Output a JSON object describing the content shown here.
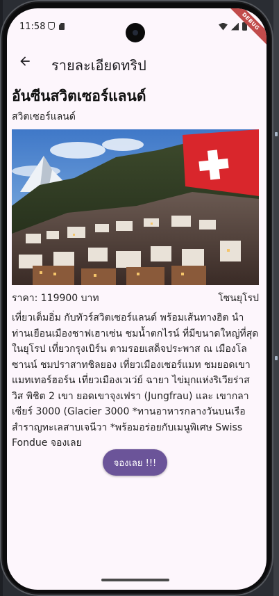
{
  "status_bar": {
    "time": "11:58",
    "icons": [
      "shield-icon",
      "sim-card-icon",
      "wifi-icon",
      "signal-icon",
      "battery-icon"
    ]
  },
  "debug_banner": "DEBUG",
  "app_bar": {
    "back_icon": "arrow-back-icon",
    "title": "รายละเอียดทริป"
  },
  "trip": {
    "name": "อันซีนสวิตเซอร์แลนด์",
    "country": "สวิตเซอร์แลนด์",
    "image_alt": "Matterhorn mountain village with Swiss flag",
    "price_label": "ราคา: 119900 บาท",
    "region": "โซนยุโรป",
    "description": "เที่ยวเต็มอิ่ม กับทัวร์สวิตเซอร์แลนด์ พร้อมเส้นทางฮิต นำท่านเยือนเมืองชาฟเฮาเซ่น ชมน้ำตกไรน์ ที่มีขนาดใหญ่ที่สุดในยุโรป เที่ยวกรุงเบิร์น ตามรอยเสด็จประพาส ณ เมืองโลซานน์ ชมปราสาทชิลยอง เที่ยวเมืองเซอร์แมท ชมยอดเขาแมทเทอร์ฮอร์น เที่ยวเมืองเวเว่ย์ ฉายา ไข่มุกแห่งริเวียร่าสวิส พิชิต 2 เขา ยอดเขาจุงเฟรา (Jungfrau) และ เขากลาเซียร์ 3000 (Glacier 3000 *ทานอาหารกลางวันบนเรือสำราญทะเลสาบเจนีวา *พร้อมอร่อยกับเมนูพิเศษ Swiss Fondue จองเลย",
    "book_label": "จองเลย !!!"
  },
  "colors": {
    "background": "#fdf6fc",
    "accent": "#6b5499",
    "debug": "#c14b4b"
  }
}
